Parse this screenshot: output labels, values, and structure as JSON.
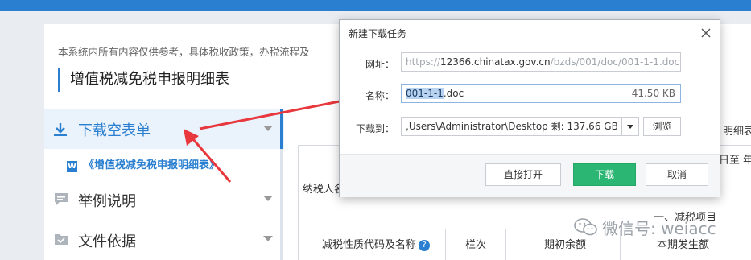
{
  "notice": "本系统内所有内容仅供参考，具体税收政策，办税流程及",
  "page_title": "增值税减免税申报明细表",
  "sidebar": {
    "items": [
      {
        "label": "下载空表单",
        "active": true
      },
      {
        "label": "举例说明"
      },
      {
        "label": "文件依据"
      }
    ],
    "sub_item": {
      "badge": "W",
      "label": "《增值税减免税申报明细表》"
    }
  },
  "document": {
    "partial_right_1": "明细表",
    "partial_right_2": "日至  年",
    "taxpayer_label": "纳税人名",
    "section_heading": "一、减税项目",
    "columns": [
      "减税性质代码及名称",
      "栏次",
      "期初余额",
      "本期发生额"
    ]
  },
  "watermark": {
    "text": "微信号: weiacc"
  },
  "dialog": {
    "title": "新建下载任务",
    "url_label": "网址：",
    "url_prefix": "https://",
    "url_domain": "12366.chinatax.gov.cn",
    "url_path": "/bzds/001/doc/001-1-1.doc",
    "name_label": "名称：",
    "file_name_selected": "001-1-1",
    "file_ext": ".doc",
    "file_size": "41.50 KB",
    "save_label": "下载到：",
    "save_path": ",Users\\Administrator\\Desktop  剩: 137.66 GB",
    "browse_label": "浏览",
    "open_label": "直接打开",
    "download_label": "下载",
    "cancel_label": "取消"
  },
  "colors": {
    "accent": "#2a7fd0",
    "download_button": "#2bb673",
    "arrow": "#e8383d",
    "selection": "#b8d3f0"
  }
}
